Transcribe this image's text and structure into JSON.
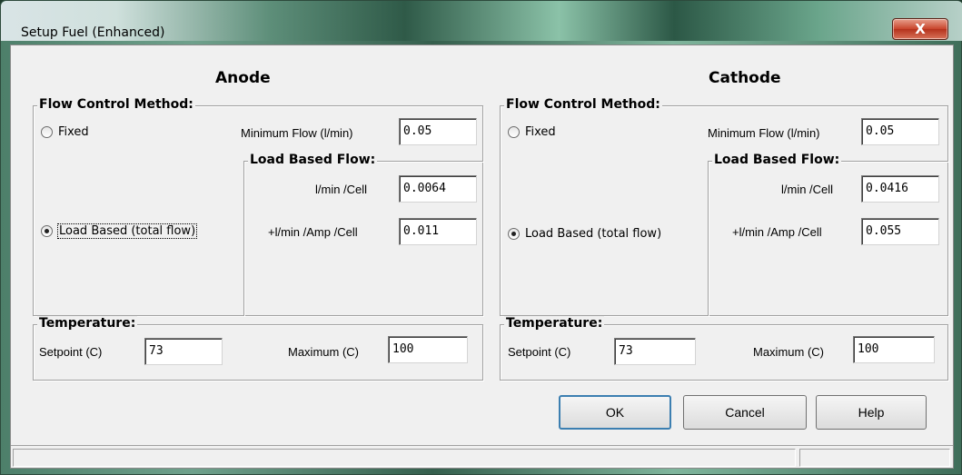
{
  "window": {
    "title": "Setup Fuel (Enhanced)",
    "close_glyph": "X"
  },
  "anode": {
    "title": "Anode",
    "flow_group": "Flow Control Method:",
    "fixed_label": "Fixed",
    "load_based_label": "Load Based (total flow)",
    "selected": "load_based",
    "min_flow_label": "Minimum Flow (l/min)",
    "min_flow_value": "0.05",
    "load_group": "Load Based Flow:",
    "per_cell_label": "l/min /Cell",
    "per_cell_value": "0.0064",
    "per_amp_label": "+l/min /Amp /Cell",
    "per_amp_value": "0.011",
    "temp_group": "Temperature:",
    "setpoint_label": "Setpoint (C)",
    "setpoint_value": "73",
    "max_label": "Maximum (C)",
    "max_value": "100"
  },
  "cathode": {
    "title": "Cathode",
    "flow_group": "Flow Control Method:",
    "fixed_label": "Fixed",
    "load_based_label": "Load Based (total flow)",
    "selected": "load_based",
    "min_flow_label": "Minimum Flow (l/min)",
    "min_flow_value": "0.05",
    "load_group": "Load Based Flow:",
    "per_cell_label": "l/min /Cell",
    "per_cell_value": "0.0416",
    "per_amp_label": "+l/min /Amp /Cell",
    "per_amp_value": "0.055",
    "temp_group": "Temperature:",
    "setpoint_label": "Setpoint (C)",
    "setpoint_value": "73",
    "max_label": "Maximum (C)",
    "max_value": "100"
  },
  "buttons": {
    "ok": "OK",
    "cancel": "Cancel",
    "help": "Help"
  }
}
